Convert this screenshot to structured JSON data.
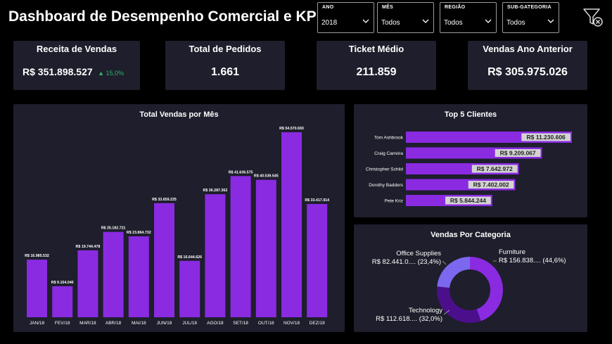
{
  "header": {
    "title": "Dashboard de Desempenho Comercial e KPIs"
  },
  "slicers": [
    {
      "label": "ANO",
      "value": "2018"
    },
    {
      "label": "MÊS",
      "value": "Todos"
    },
    {
      "label": "REGIÃO",
      "value": "Todos"
    },
    {
      "label": "SUB-GATEGORIA",
      "value": "Todos"
    }
  ],
  "filter_icon": "clear-filter-icon",
  "kpis": {
    "receita": {
      "title": "Receita de Vendas",
      "value": "R$ 351.898.527",
      "delta": "▲ 15,0%",
      "delta_color": "#2db56c"
    },
    "pedidos": {
      "title": "Total de Pedidos",
      "value": "1.661"
    },
    "ticket": {
      "title": "Ticket Médio",
      "value": "211.859"
    },
    "anterior": {
      "title": "Vendas Ano Anterior",
      "value": "R$ 305.975.026"
    }
  },
  "colors": {
    "bar": "#8a2be2",
    "panel": "#1e1e2c",
    "donut_furniture": "#8a2be2",
    "donut_technology": "#4b0f8c",
    "donut_office": "#7b68ee"
  },
  "chart_data": [
    {
      "type": "bar",
      "title": "Total Vendas por Mês",
      "categories": [
        "JAN/18",
        "FEV/18",
        "MAR/18",
        "ABR/18",
        "MAI/18",
        "JUN/18",
        "JUL/18",
        "AGO/18",
        "SET/18",
        "OUT/18",
        "NOV/18",
        "DEZ/18"
      ],
      "values": [
        16985532,
        9154040,
        19744478,
        25182721,
        23864732,
        33659225,
        16644626,
        36287362,
        41636575,
        40539545,
        54570693,
        33417914
      ],
      "labels": [
        "R$ 16.985.532",
        "R$ 9.154.040",
        "R$ 19.744.478",
        "R$ 25.182.721",
        "R$ 23.864.732",
        "R$ 33.659.225",
        "R$ 16.644.626",
        "R$ 36.287.362",
        "R$ 41.636.575",
        "R$ 40.539.545",
        "R$ 54.570.693",
        "R$ 33.417.914"
      ]
    },
    {
      "type": "bar",
      "orientation": "horizontal",
      "title": "Top 5 Clientes",
      "categories": [
        "Tom Ashbrook",
        "Craig Carreira",
        "Christopher Schild",
        "Dorothy Badders",
        "Pete Kriz"
      ],
      "values": [
        11230606,
        9209067,
        7642972,
        7402002,
        5844244
      ],
      "labels": [
        "R$ 11.230.606",
        "R$ 9.209.067",
        "R$ 7.642.972",
        "R$ 7.402.002",
        "R$ 5.844.244"
      ]
    },
    {
      "type": "pie",
      "title": "Vendas Por Categoria",
      "categories": [
        "Furniture",
        "Technology",
        "Office Supplies"
      ],
      "values": [
        44.6,
        32.0,
        23.4
      ],
      "labels": [
        "R$ 156.838.... (44,6%)",
        "R$ 112.618.... (32,0%)",
        "R$ 82.441.0.... (23,4%)"
      ]
    }
  ]
}
